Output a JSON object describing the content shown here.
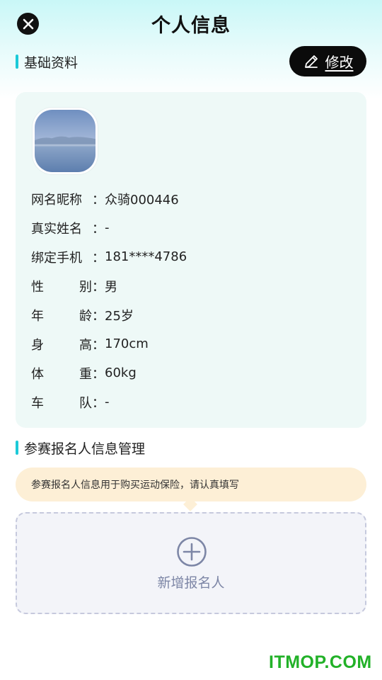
{
  "header": {
    "title": "个人信息",
    "close_icon": "close-icon"
  },
  "basic": {
    "section_title": "基础资料",
    "edit_label": "修改",
    "edit_icon": "pencil-icon",
    "accent_color": "#1ccad8",
    "rows": [
      {
        "key_a": "网名昵称",
        "key_b": "",
        "value": "众骑000446"
      },
      {
        "key_a": "真实姓名",
        "key_b": "",
        "value": "-"
      },
      {
        "key_a": "绑定手机",
        "key_b": "",
        "value": "181****4786"
      },
      {
        "key_a": "性",
        "key_b": "别",
        "value": "男"
      },
      {
        "key_a": "年",
        "key_b": "龄",
        "value": "25岁"
      },
      {
        "key_a": "身",
        "key_b": "高",
        "value": "170cm"
      },
      {
        "key_a": "体",
        "key_b": "重",
        "value": "60kg"
      },
      {
        "key_a": "车",
        "key_b": "队",
        "value": "-"
      }
    ],
    "colon": "："
  },
  "registrant": {
    "section_title": "参赛报名人信息管理",
    "tip": "参赛报名人信息用于购买运动保险，请认真填写",
    "add_label": "新增报名人",
    "add_icon": "plus-circle-icon"
  },
  "watermark": "ITMOP.COM"
}
